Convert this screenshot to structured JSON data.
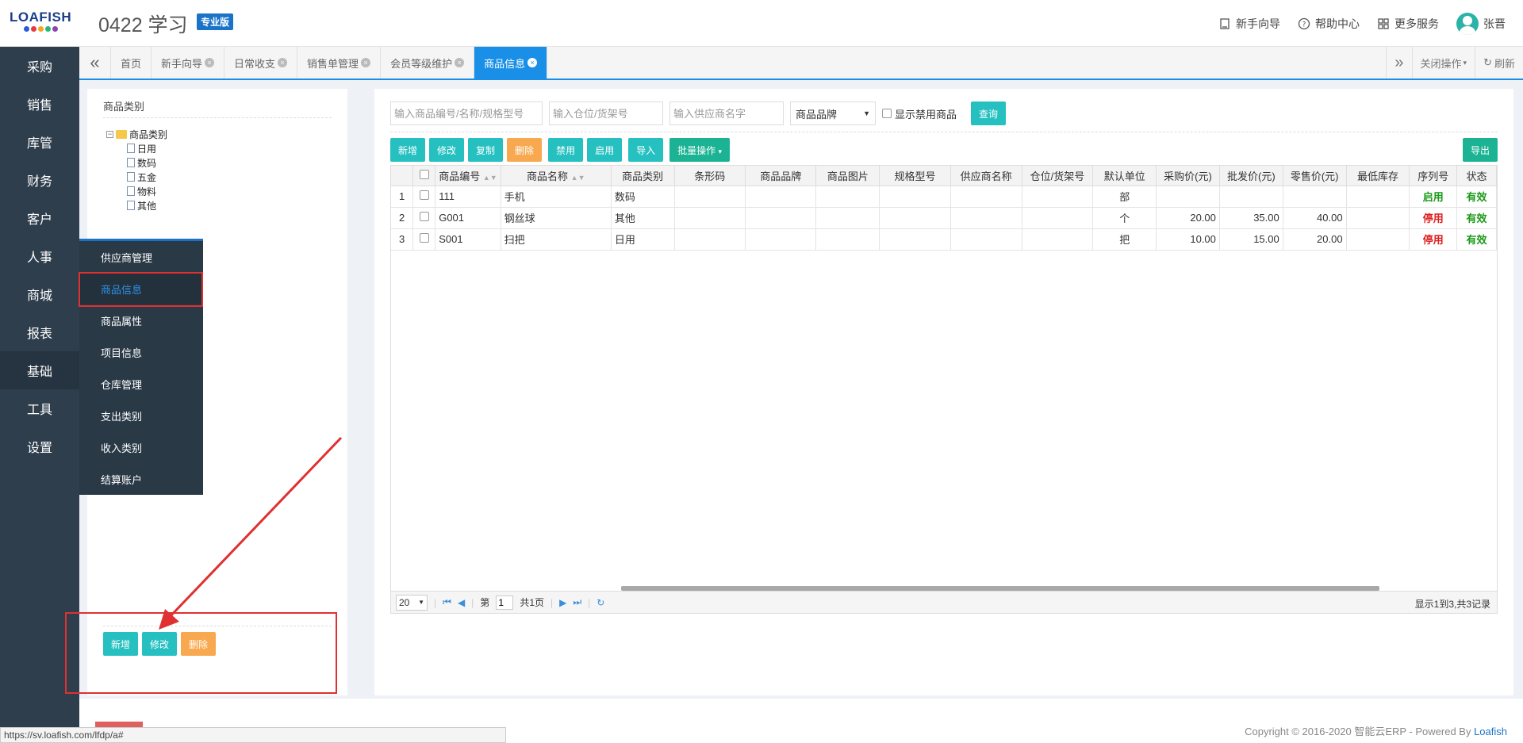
{
  "header": {
    "logo_text": "LOAFISH",
    "logo_dot_colors": [
      "#2a5bd7",
      "#e23c3c",
      "#f6a623",
      "#2bb673",
      "#8e44ad"
    ],
    "app_title": "0422 学习",
    "edition": "专业版",
    "right_items": [
      {
        "label": "新手向导",
        "icon": "guide-icon"
      },
      {
        "label": "帮助中心",
        "icon": "help-icon"
      },
      {
        "label": "更多服务",
        "icon": "grid-icon"
      }
    ],
    "user_name": "张晋"
  },
  "left_nav": {
    "items": [
      {
        "label": "采购"
      },
      {
        "label": "销售"
      },
      {
        "label": "库管"
      },
      {
        "label": "财务"
      },
      {
        "label": "客户"
      },
      {
        "label": "人事"
      },
      {
        "label": "商城"
      },
      {
        "label": "报表"
      },
      {
        "label": "基础"
      },
      {
        "label": "工具"
      },
      {
        "label": "设置"
      }
    ],
    "active": "基础"
  },
  "submenu": {
    "items": [
      {
        "label": "供应商管理"
      },
      {
        "label": "商品信息"
      },
      {
        "label": "商品属性"
      },
      {
        "label": "项目信息"
      },
      {
        "label": "仓库管理"
      },
      {
        "label": "支出类别"
      },
      {
        "label": "收入类别"
      },
      {
        "label": "结算账户"
      }
    ],
    "active": "商品信息"
  },
  "tabbar": {
    "tabs": [
      {
        "label": "首页",
        "closable": false
      },
      {
        "label": "新手向导",
        "closable": true
      },
      {
        "label": "日常收支",
        "closable": true
      },
      {
        "label": "销售单管理",
        "closable": true
      },
      {
        "label": "会员等级维护",
        "closable": true
      },
      {
        "label": "商品信息",
        "closable": true
      }
    ],
    "active": "商品信息",
    "close_ops": "关闭操作",
    "refresh": "刷新"
  },
  "category_panel": {
    "title": "商品类别",
    "root": "商品类别",
    "children": [
      "日用",
      "数码",
      "五金",
      "物料",
      "其他"
    ],
    "buttons": {
      "add": "新增",
      "edit": "修改",
      "delete": "删除"
    }
  },
  "search": {
    "code_placeholder": "输入商品编号/名称/规格型号",
    "location_placeholder": "输入仓位/货架号",
    "supplier_placeholder": "输入供应商名字",
    "brand_select": "商品品牌",
    "show_disabled": "显示禁用商品",
    "query": "查询"
  },
  "actions": {
    "add": "新增",
    "edit": "修改",
    "copy": "复制",
    "delete": "删除",
    "disable": "禁用",
    "enable": "启用",
    "import": "导入",
    "batch": "批量操作",
    "export": "导出"
  },
  "table": {
    "columns": [
      "商品编号",
      "商品名称",
      "商品类别",
      "条形码",
      "商品品牌",
      "商品图片",
      "规格型号",
      "供应商名称",
      "仓位/货架号",
      "默认单位",
      "采购价(元)",
      "批发价(元)",
      "零售价(元)",
      "最低库存",
      "序列号",
      "状态"
    ],
    "rows": [
      {
        "no": "1",
        "code": "111",
        "name": "手机",
        "category": "数码",
        "barcode": "",
        "brand": "",
        "image": "",
        "spec": "",
        "supplier": "",
        "location": "",
        "unit": "部",
        "purchase": "",
        "wholesale": "",
        "retail": "",
        "min_stock": "",
        "serial": "启用",
        "status": "有效"
      },
      {
        "no": "2",
        "code": "G001",
        "name": "钢丝球",
        "category": "其他",
        "barcode": "",
        "brand": "",
        "image": "",
        "spec": "",
        "supplier": "",
        "location": "",
        "unit": "个",
        "purchase": "20.00",
        "wholesale": "35.00",
        "retail": "40.00",
        "min_stock": "",
        "serial": "停用",
        "status": "有效"
      },
      {
        "no": "3",
        "code": "S001",
        "name": "扫把",
        "category": "日用",
        "barcode": "",
        "brand": "",
        "image": "",
        "spec": "",
        "supplier": "",
        "location": "",
        "unit": "把",
        "purchase": "10.00",
        "wholesale": "15.00",
        "retail": "20.00",
        "min_stock": "",
        "serial": "停用",
        "status": "有效"
      }
    ]
  },
  "pager": {
    "page_size": "20",
    "page_prefix": "第",
    "page": "1",
    "total_pages": "共1页",
    "info": "显示1到3,共3记录"
  },
  "footer": {
    "copyright": "Copyright © 2016-2020 智能云ERP - Powered By ",
    "brand_link": "Loafish",
    "status_url": "https://sv.loafish.com/lfdp/a#"
  },
  "colors": {
    "nav_bg": "#2f3e4c",
    "accent_blue": "#1a8fe8",
    "teal": "#26c0c0",
    "orange": "#f8a84e",
    "green": "#1bb394",
    "annotation_red": "#e03030"
  }
}
